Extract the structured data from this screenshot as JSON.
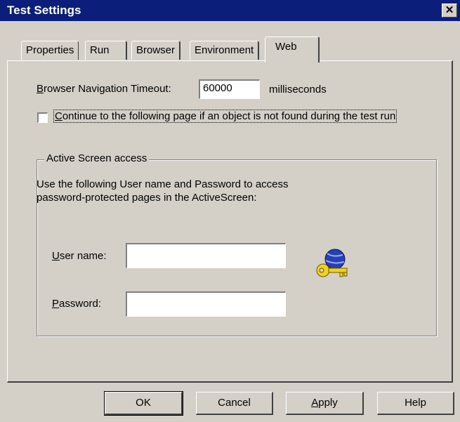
{
  "window": {
    "title": "Test Settings"
  },
  "tabs": [
    {
      "label": "Properties"
    },
    {
      "label": "Run"
    },
    {
      "label": "Browser"
    },
    {
      "label": "Environment"
    },
    {
      "label": "Web",
      "active": true
    }
  ],
  "web": {
    "timeout_label_first": "B",
    "timeout_label_rest": "rowser Navigation Timeout:",
    "timeout_value": "60000",
    "timeout_unit": "milliseconds",
    "continue_first": "C",
    "continue_rest": "ontinue to the following page if an object is not found during the test run",
    "continue_checked": false,
    "active_screen": {
      "title": "Active Screen access",
      "description_line1": "Use the following User name and Password to access",
      "description_line2": "password-protected pages in the ActiveScreen:",
      "username_first": "U",
      "username_rest": "ser name:",
      "username_value": "",
      "password_first": "P",
      "password_rest": "assword:",
      "password_value": ""
    }
  },
  "buttons": {
    "ok": "OK",
    "cancel": "Cancel",
    "apply_first": "A",
    "apply_rest": "pply",
    "help": "Help"
  }
}
